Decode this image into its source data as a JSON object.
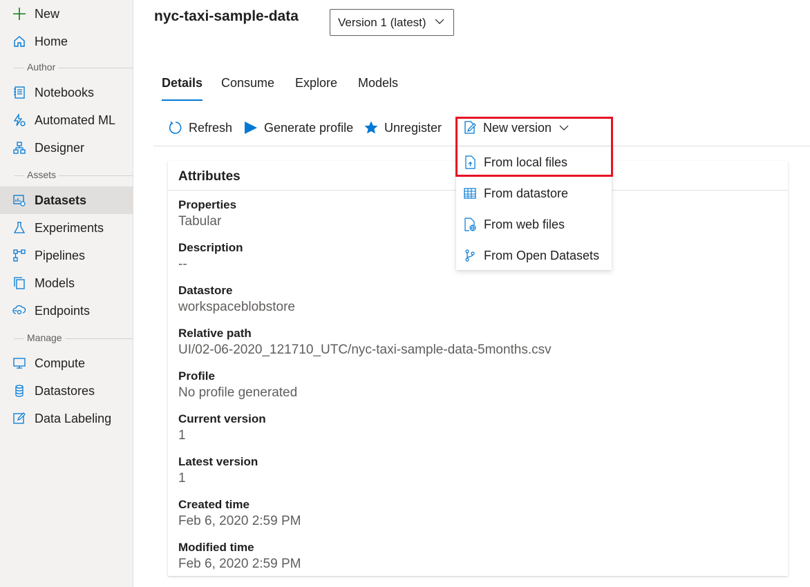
{
  "sidebar": {
    "new_label": "New",
    "home_label": "Home",
    "sections": {
      "author": "Author",
      "assets": "Assets",
      "manage": "Manage"
    },
    "items": [
      {
        "label": "Notebooks",
        "icon": "notebook-icon"
      },
      {
        "label": "Automated ML",
        "icon": "automated-ml-icon"
      },
      {
        "label": "Designer",
        "icon": "designer-icon"
      },
      {
        "label": "Datasets",
        "icon": "datasets-icon",
        "active": true
      },
      {
        "label": "Experiments",
        "icon": "flask-icon"
      },
      {
        "label": "Pipelines",
        "icon": "pipeline-icon"
      },
      {
        "label": "Models",
        "icon": "models-icon"
      },
      {
        "label": "Endpoints",
        "icon": "endpoints-icon"
      },
      {
        "label": "Compute",
        "icon": "compute-icon"
      },
      {
        "label": "Datastores",
        "icon": "database-icon"
      },
      {
        "label": "Data Labeling",
        "icon": "edit-icon"
      }
    ]
  },
  "header": {
    "title": "nyc-taxi-sample-data",
    "version_selected": "Version 1 (latest)"
  },
  "tabs": [
    "Details",
    "Consume",
    "Explore",
    "Models"
  ],
  "toolbar": {
    "refresh": "Refresh",
    "generate_profile": "Generate profile",
    "unregister": "Unregister",
    "new_version": "New version"
  },
  "new_version_menu": {
    "items": [
      "From local files",
      "From datastore",
      "From web files",
      "From Open Datasets"
    ]
  },
  "attributes": {
    "title": "Attributes",
    "properties": [
      {
        "label": "Properties",
        "value": "Tabular"
      },
      {
        "label": "Description",
        "value": "--"
      },
      {
        "label": "Datastore",
        "value": "workspaceblobstore"
      },
      {
        "label": "Relative path",
        "value": "UI/02-06-2020_121710_UTC/nyc-taxi-sample-data-5months.csv"
      },
      {
        "label": "Profile",
        "value": "No profile generated"
      },
      {
        "label": "Current version",
        "value": "1"
      },
      {
        "label": "Latest version",
        "value": "1"
      },
      {
        "label": "Created time",
        "value": "Feb 6, 2020 2:59 PM"
      },
      {
        "label": "Modified time",
        "value": "Feb 6, 2020 2:59 PM"
      }
    ]
  },
  "colors": {
    "accent": "#0078d4",
    "highlight": "#e81123",
    "new_icon": "#107c10"
  }
}
